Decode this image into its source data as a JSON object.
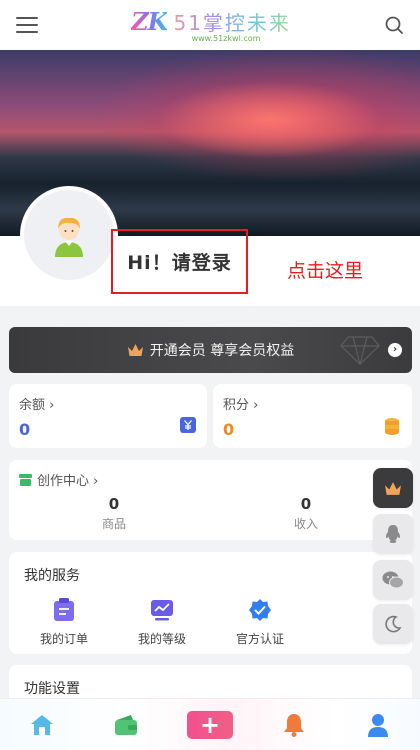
{
  "header": {
    "logo_mark": "ZK",
    "logo_text": "51掌控未来",
    "logo_url": "www.51zkwl.com",
    "icons": {
      "menu": "menu-icon",
      "search": "search-icon"
    }
  },
  "profile": {
    "login_text": "Hi！请登录",
    "annotation": "点击这里",
    "annotation_color": "#e02020"
  },
  "vip_banner": {
    "label": "开通会员 尊享会员权益",
    "crown_color": "#f0a45a"
  },
  "wallet": {
    "balance": {
      "label": "余额 ›",
      "value": "0",
      "color": "#4a64e0"
    },
    "points": {
      "label": "积分 ›",
      "value": "0",
      "color": "#f08a1c"
    }
  },
  "creation_center": {
    "title": "创作中心 ›",
    "stats": [
      {
        "value": "0",
        "label": "商品"
      },
      {
        "value": "0",
        "label": "收入"
      }
    ]
  },
  "services": {
    "title": "我的服务",
    "items": [
      {
        "label": "我的订单",
        "icon": "clipboard-icon"
      },
      {
        "label": "我的等级",
        "icon": "level-chart-icon"
      },
      {
        "label": "官方认证",
        "icon": "verified-badge-icon"
      }
    ]
  },
  "settings": {
    "title": "功能设置"
  },
  "side_buttons": [
    "crown-icon",
    "qq-icon",
    "wechat-icon",
    "moon-icon"
  ],
  "bottom_nav": [
    "home-icon",
    "wallet-icon",
    "plus-icon",
    "bell-icon",
    "user-icon"
  ]
}
